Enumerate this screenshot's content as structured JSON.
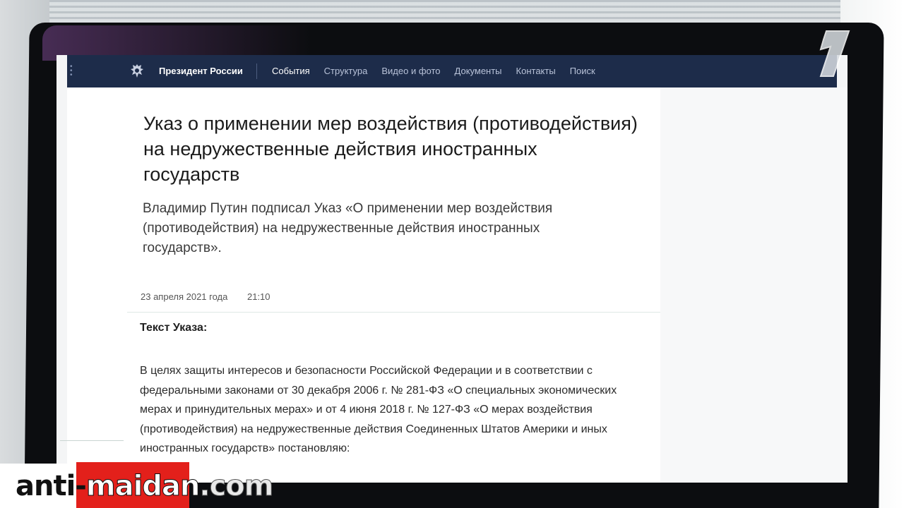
{
  "site": {
    "name": "Президент России",
    "nav": [
      "События",
      "Структура",
      "Видео и фото",
      "Документы",
      "Контакты",
      "Поиск"
    ]
  },
  "article": {
    "title": "Указ о применении мер воздействия (противодействия) на недружественные действия иностранных государств",
    "lead": "Владимир Путин подписал Указ «О применении мер воздействия (противодействия) на недружественные действия иностранных государств».",
    "date": "23 апреля 2021 года",
    "time": "21:10",
    "section_title": "Текст Указа:",
    "body": "В целях защиты интересов и безопасности Российской Федерации и в соответствии с федеральными законами от 30 декабря 2006 г. № 281-ФЗ «О специальных экономических мерах и принудительных мерах» и от 4 июня 2018 г. № 127-ФЗ «О мерах воздействия (противодействия) на недружественные действия Соединенных Штатов Америки и иных иностранных государств» постановляю:"
  },
  "watermark": {
    "part1": "anti-",
    "part2": "maidan",
    "part3": ".com"
  },
  "colors": {
    "header": "#1d2c4a",
    "watermark_red": "#e3201b"
  }
}
